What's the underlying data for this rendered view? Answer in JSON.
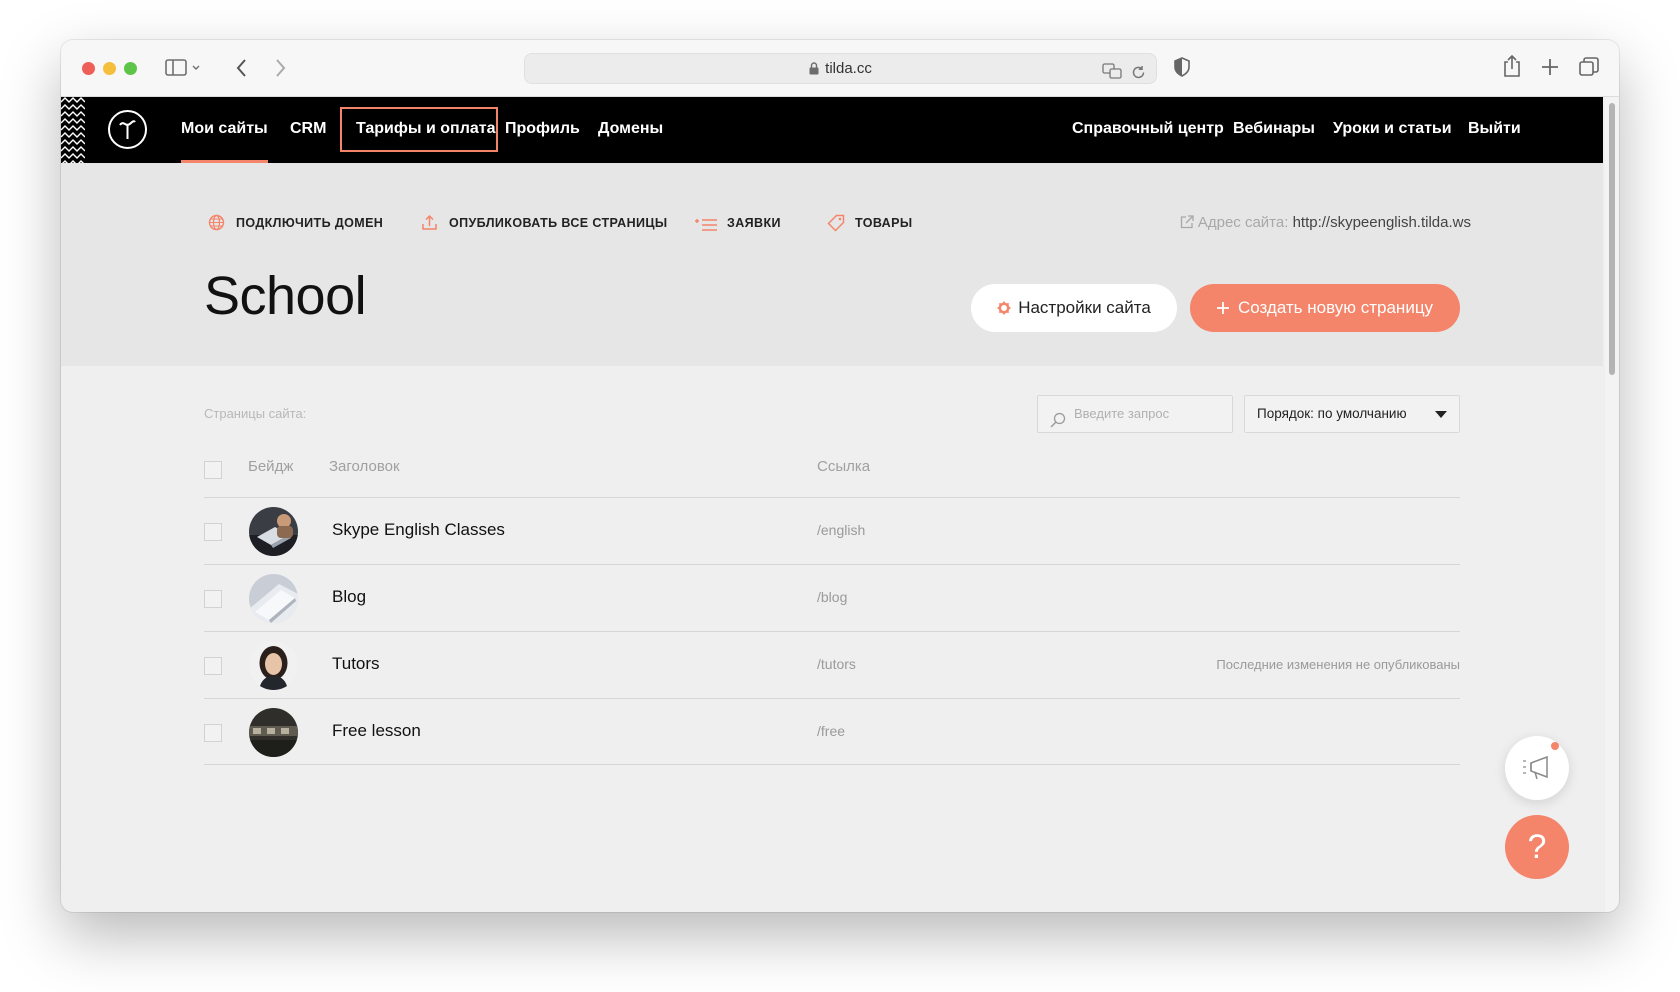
{
  "browser": {
    "url": "tilda.cc"
  },
  "nav": {
    "left": [
      {
        "label": "Мои сайты"
      },
      {
        "label": "CRM"
      },
      {
        "label": "Тарифы и оплата"
      },
      {
        "label": "Профиль"
      },
      {
        "label": "Домены"
      }
    ],
    "right": [
      {
        "label": "Справочный центр"
      },
      {
        "label": "Вебинары"
      },
      {
        "label": "Уроки и статьи"
      },
      {
        "label": "Выйти"
      }
    ],
    "active": "Мои сайты",
    "highlighted": "Тарифы и оплата"
  },
  "actions": {
    "connect_domain": "ПОДКЛЮЧИТЬ ДОМЕН",
    "publish_all": "ОПУБЛИКОВАТЬ ВСЕ СТРАНИЦЫ",
    "leads": "ЗАЯВКИ",
    "products": "ТОВАРЫ"
  },
  "site_address": {
    "label": "Адрес сайта:",
    "value": "http://skypeenglish.tilda.ws"
  },
  "site": {
    "title": "School",
    "settings_button": "Настройки сайта",
    "create_button": "Создать новую страницу"
  },
  "pages": {
    "label": "Страницы сайта:",
    "search_placeholder": "Введите запрос",
    "sort_label": "Порядок: по умолчанию",
    "columns": {
      "badge": "Бейдж",
      "title": "Заголовок",
      "link": "Ссылка"
    },
    "rows": [
      {
        "title": "Skype English Classes",
        "link": "/english",
        "note": ""
      },
      {
        "title": "Blog",
        "link": "/blog",
        "note": ""
      },
      {
        "title": "Tutors",
        "link": "/tutors",
        "note": "Последние изменения не опубликованы"
      },
      {
        "title": "Free lesson",
        "link": "/free",
        "note": ""
      }
    ]
  },
  "help": {
    "symbol": "?"
  },
  "colors": {
    "accent": "#f4846a",
    "nav_bg": "#000000",
    "header_bg": "#e6e6e6",
    "body_bg": "#efefef"
  }
}
